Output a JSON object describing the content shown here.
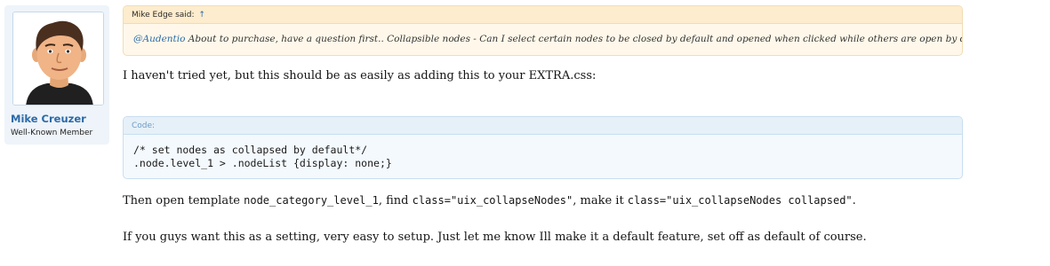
{
  "user": {
    "name": "Mike Creuzer",
    "title": "Well-Known Member"
  },
  "quote": {
    "author_line": "Mike Edge said:",
    "jump_arrow": "↑",
    "mention": "@Audentio",
    "text": " About to purchase, have a question first.. Collapsible nodes - Can I select certain nodes to be closed by default and opened when clicked while others are open by default?"
  },
  "post": {
    "intro": "I haven't tried yet, but this should be as easily as adding this to your EXTRA.css:",
    "code_label": "Code:",
    "code_line_1": "/* set nodes as collapsed by default*/",
    "code_line_2": ".node.level_1 > .nodeList {display: none;}",
    "instr_1": "Then open template ",
    "instr_template": "node_category_level_1",
    "instr_2": ", find ",
    "instr_class_old": "class=\"uix_collapseNodes\"",
    "instr_3": ", make it ",
    "instr_class_new": "class=\"uix_collapseNodes collapsed\"",
    "instr_4": ".",
    "closing": "If you guys want this as a setting, very easy to setup. Just let me know Ill make it a default feature, set off as default of course."
  },
  "colors": {
    "link": "#2b6aa8",
    "quote_bg": "#fff8ea",
    "quote_border": "#f2dcb5",
    "code_bg": "#f4f9fd",
    "code_border": "#c9def0",
    "sidebar_bg": "#eef4fa"
  }
}
